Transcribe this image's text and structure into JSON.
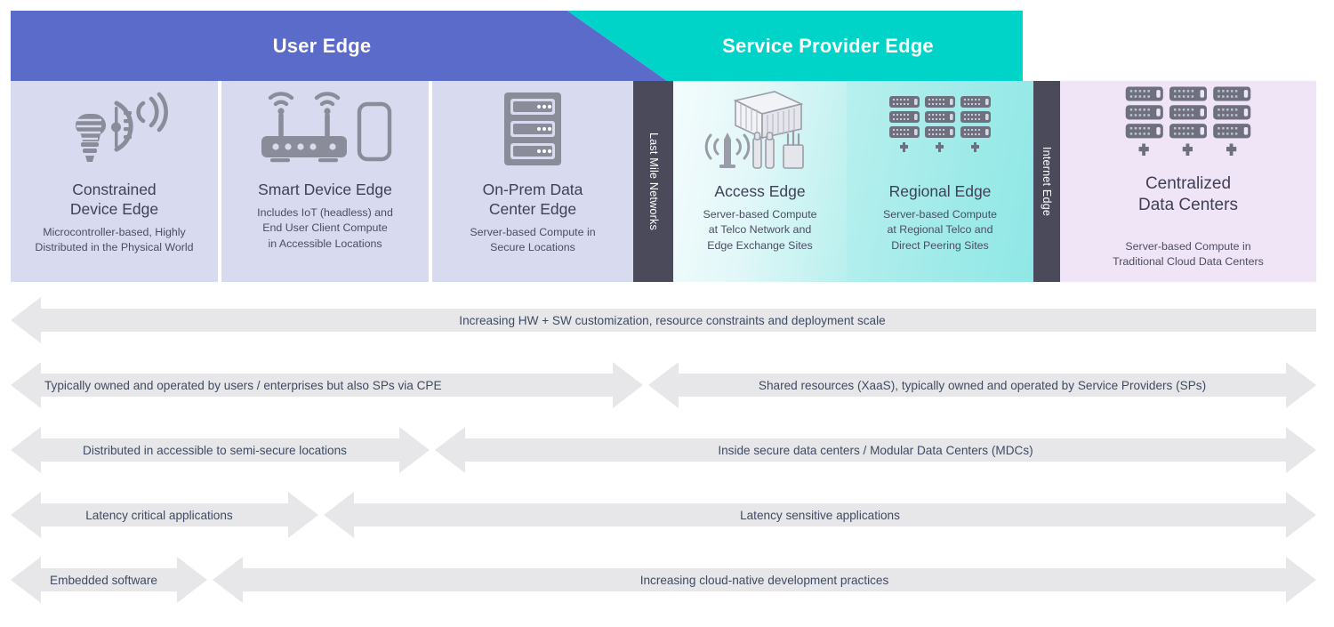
{
  "banner": {
    "user_edge_label": "User Edge",
    "service_provider_edge_label": "Service Provider Edge",
    "user_edge_color": "#5b6bca",
    "service_provider_edge_color": "#00d4c8"
  },
  "columns": [
    {
      "id": "constrained-device-edge",
      "title": "Constrained\nDevice Edge",
      "title_line1": "Constrained",
      "title_line2": "Device Edge",
      "subtitle_line1": "Microcontroller-based, Highly",
      "subtitle_line2": "Distributed in the Physical World",
      "icon": "smart-bulb-thermostat-wifi-icon",
      "background": "#d8dbf0"
    },
    {
      "id": "smart-device-edge",
      "title_line1": "Smart Device Edge",
      "title_line2": "",
      "subtitle_line1": "Includes IoT (headless) and",
      "subtitle_line2": "End User Client Compute",
      "subtitle_line3": "in Accessible Locations",
      "icon": "router-and-phone-icon",
      "background": "#d8dbf0"
    },
    {
      "id": "on-prem-data-center-edge",
      "title_line1": "On-Prem Data",
      "title_line2": "Center Edge",
      "subtitle_line1": "Server-based Compute in",
      "subtitle_line2": "Secure Locations",
      "icon": "server-rack-icon",
      "background": "#d8dbf0"
    },
    {
      "id": "access-edge",
      "title_line1": "Access Edge",
      "title_line2": "",
      "subtitle_line1": "Server-based Compute",
      "subtitle_line2": "at Telco Network and",
      "subtitle_line3": "Edge Exchange Sites",
      "icon": "modular-data-center-tower-cables-icon",
      "background": "teal-gradient-light"
    },
    {
      "id": "regional-edge",
      "title_line1": "Regional Edge",
      "title_line2": "",
      "subtitle_line1": "Server-based Compute",
      "subtitle_line2": "at Regional Telco and",
      "subtitle_line3": "Direct Peering Sites",
      "icon": "server-blade-grid-icon",
      "background": "teal-gradient"
    },
    {
      "id": "centralized-data-centers",
      "title_line1": "Centralized",
      "title_line2": "Data Centers",
      "subtitle_line1": "Server-based Compute in",
      "subtitle_line2": "Traditional Cloud Data Centers",
      "icon": "server-blade-grid-icon",
      "background": "#efe5f6"
    }
  ],
  "dividers": [
    {
      "id": "last-mile-networks",
      "label": "Last Mile Networks",
      "color": "#4a4a5a"
    },
    {
      "id": "internet-edge",
      "label": "Internet Edge",
      "color": "#4a4a5a"
    }
  ],
  "arrow_rows": [
    {
      "id": "customization-scale",
      "segments": [
        {
          "text": "Increasing HW + SW customization, resource constraints and deployment scale",
          "direction": "left",
          "align": "center"
        }
      ]
    },
    {
      "id": "ownership",
      "segments": [
        {
          "text": "Typically owned and operated by users / enterprises but also SPs via CPE",
          "direction": "both",
          "align": "left"
        },
        {
          "text": "Shared resources (XaaS), typically owned and operated by Service Providers (SPs)",
          "direction": "both",
          "align": "center"
        }
      ]
    },
    {
      "id": "location-security",
      "segments": [
        {
          "text": "Distributed in accessible to semi-secure locations",
          "direction": "both",
          "align": "center"
        },
        {
          "text": "Inside secure data centers / Modular Data Centers (MDCs)",
          "direction": "both",
          "align": "center"
        }
      ]
    },
    {
      "id": "latency",
      "segments": [
        {
          "text": "Latency critical applications",
          "direction": "both",
          "align": "center"
        },
        {
          "text": "Latency sensitive applications",
          "direction": "both",
          "align": "center"
        }
      ]
    },
    {
      "id": "software-practices",
      "segments": [
        {
          "text": "Embedded software",
          "direction": "both",
          "align": "center"
        },
        {
          "text": "Increasing cloud-native development practices",
          "direction": "both",
          "align": "center"
        }
      ]
    }
  ],
  "colors": {
    "arrow_fill": "#e7e7e9",
    "arrow_text": "#3f4a63",
    "column_text": "#3f3f56",
    "icon_gray": "#7d7f8c",
    "divider": "#4a4a5a"
  }
}
